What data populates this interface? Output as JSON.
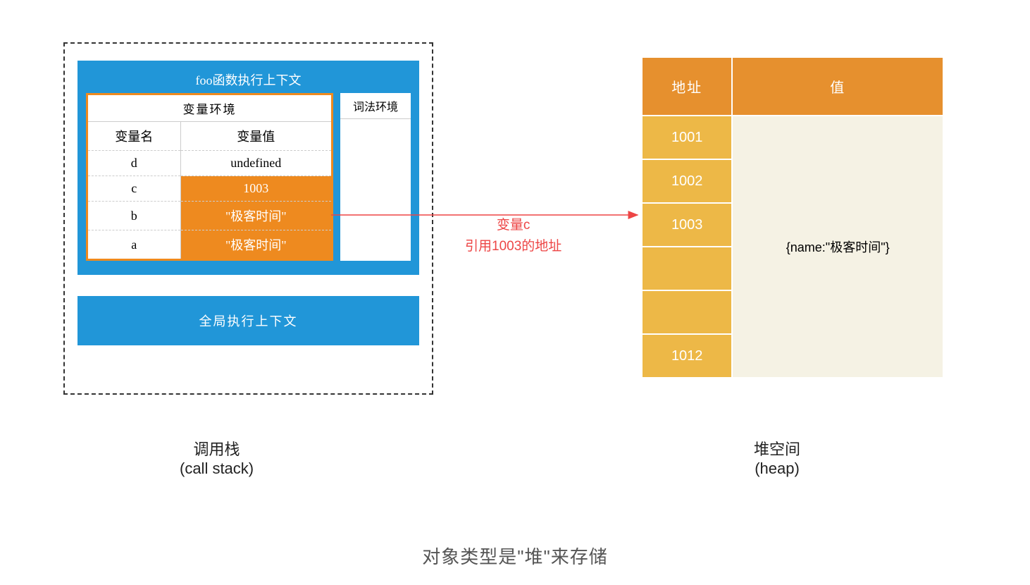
{
  "callStack": {
    "fooContextTitle": "foo函数执行上下文",
    "varEnv": {
      "header": "变量环境",
      "colName": "变量名",
      "colValue": "变量值",
      "rows": [
        {
          "name": "d",
          "value": "undefined",
          "highlight": false
        },
        {
          "name": "c",
          "value": "1003",
          "highlight": true
        },
        {
          "name": "b",
          "value": "\"极客时间\"",
          "highlight": true
        },
        {
          "name": "a",
          "value": "\"极客时间\"",
          "highlight": true
        }
      ]
    },
    "lexEnvTitle": "词法环境",
    "globalContext": "全局执行上下文",
    "captionLine1": "调用栈",
    "captionLine2": "(call stack)"
  },
  "arrow": {
    "labelLine1": "变量c",
    "labelLine2": "引用1003的地址"
  },
  "heap": {
    "headerAddr": "地址",
    "headerVal": "值",
    "addresses": [
      "1001",
      "1002",
      "1003",
      "",
      "",
      "1012"
    ],
    "valueCell": "{name:\"极客时间\"}",
    "captionLine1": "堆空间",
    "captionLine2": "(heap)"
  },
  "bottomCaption": "对象类型是\"堆\"来存储"
}
